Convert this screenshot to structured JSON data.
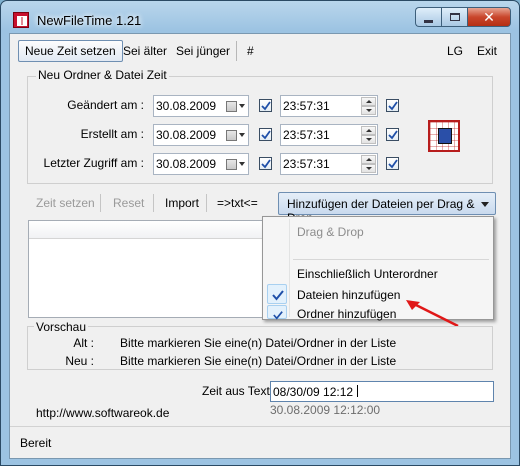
{
  "window": {
    "title": "NewFileTime 1.21"
  },
  "menu": {
    "items": [
      "Neue Zeit setzen",
      "Sei älter",
      "Sei jünger",
      "#",
      "LG",
      "Exit"
    ]
  },
  "group": {
    "title": "Neu Ordner & Datei Zeit",
    "rows": [
      {
        "label": "Geändert am :",
        "date": "30.08.2009",
        "time": "23:57:31",
        "date_checked": true,
        "time_checked": true
      },
      {
        "label": "Erstellt am :",
        "date": "30.08.2009",
        "time": "23:57:31",
        "date_checked": true,
        "time_checked": true
      },
      {
        "label": "Letzter Zugriff am :",
        "date": "30.08.2009",
        "time": "23:57:31",
        "date_checked": true,
        "time_checked": true
      }
    ]
  },
  "toolbar": {
    "zeit_setzen": "Zeit setzen",
    "reset": "Reset",
    "import": "Import",
    "txt": "=>txt<=",
    "dropdown": "Hinzufügen der Dateien per Drag & Drop"
  },
  "popup": {
    "header": "Drag & Drop",
    "items": [
      {
        "label": "Einschließlich Unterordner",
        "checked": false
      },
      {
        "label": "Dateien hinzufügen",
        "checked": true
      },
      {
        "label": "Ordner hinzufügen",
        "checked": true
      }
    ]
  },
  "preview": {
    "title": "Vorschau",
    "alt_label": "Alt :",
    "alt_value": "Bitte markieren Sie eine(n) Datei/Ordner in der Liste",
    "neu_label": "Neu :",
    "neu_value": "Bitte markieren Sie eine(n) Datei/Ordner in der Liste"
  },
  "zeit_aus_text": {
    "label": "Zeit aus Text",
    "value": "08/30/09 12:12",
    "result": "30.08.2009 12:12:00"
  },
  "website": "http://www.softwareok.de",
  "status": "Bereit",
  "colors": {
    "accent": "#cc2222",
    "check_blue": "#1f4fa8"
  }
}
